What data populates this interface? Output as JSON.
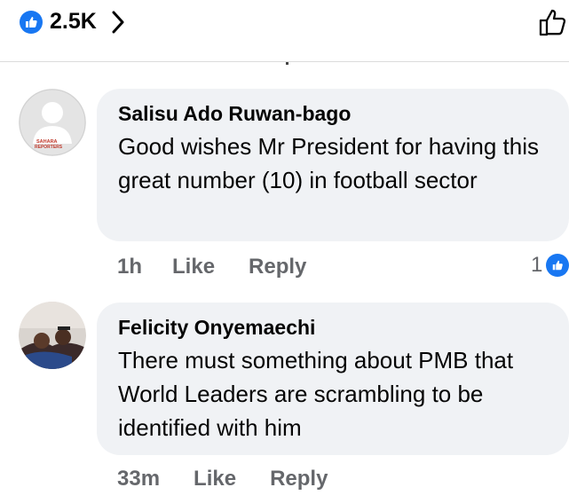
{
  "reactions": {
    "count": "2.5K"
  },
  "comments": [
    {
      "author": "Salisu Ado Ruwan-bago",
      "text": "Good wishes Mr President for having this great number (10) in football sector",
      "time": "1h",
      "like_label": "Like",
      "reply_label": "Reply",
      "reaction_count": "1",
      "avatar_lines": [
        "SAHARA",
        "REPORTERS"
      ]
    },
    {
      "author": "Felicity Onyemaechi",
      "text": "There must something about PMB that World Leaders are scrambling to be identified with him",
      "time": "33m",
      "like_label": "Like",
      "reply_label": "Reply"
    }
  ],
  "colors": {
    "accent": "#1877f2",
    "bubble": "#f0f2f5",
    "meta": "#65676b"
  }
}
